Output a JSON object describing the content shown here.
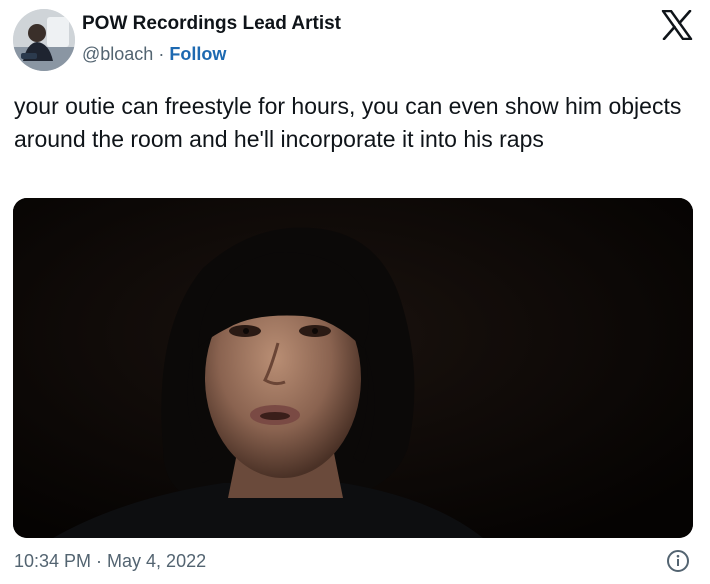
{
  "author": {
    "name": "POW Recordings Lead Artist",
    "handle": "@bloach",
    "separator": "·",
    "follow_label": "Follow"
  },
  "tweet": {
    "text": "your outie can freestyle for hours, you can even show him objects around the room and he'll incorporate it into his raps"
  },
  "footer": {
    "timestamp": "10:34 PM · May 4, 2022"
  },
  "icons": {
    "brand": "x-logo-icon",
    "info": "info-icon"
  },
  "colors": {
    "text": "#0f1419",
    "secondary": "#536471",
    "follow": "#1d69b1",
    "media_background": "#0a0706"
  }
}
